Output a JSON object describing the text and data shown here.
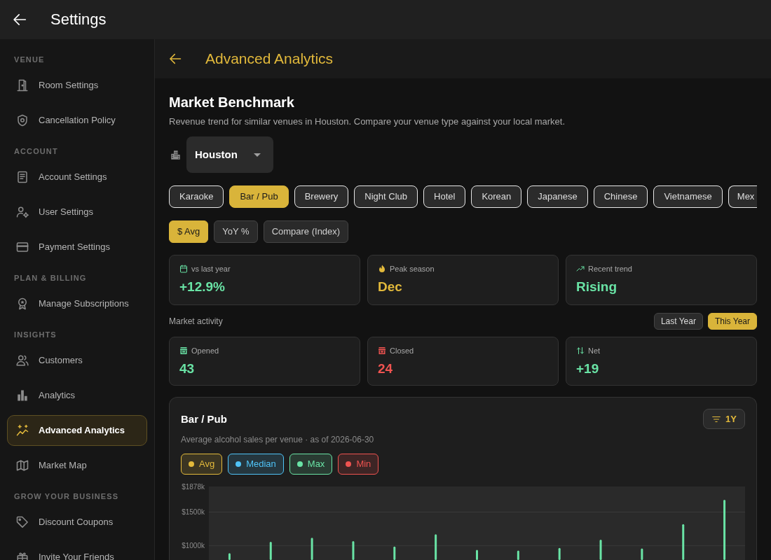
{
  "app_bar": {
    "title": "Settings"
  },
  "sidebar": {
    "sections": [
      {
        "heading": "VENUE",
        "items": [
          {
            "label": "Room Settings",
            "selected": false
          },
          {
            "label": "Cancellation Policy",
            "selected": false
          }
        ]
      },
      {
        "heading": "ACCOUNT",
        "items": [
          {
            "label": "Account Settings",
            "selected": false
          },
          {
            "label": "User Settings",
            "selected": false
          },
          {
            "label": "Payment Settings",
            "selected": false
          }
        ]
      },
      {
        "heading": "PLAN & BILLING",
        "items": [
          {
            "label": "Manage Subscriptions",
            "selected": false
          }
        ]
      },
      {
        "heading": "INSIGHTS",
        "items": [
          {
            "label": "Customers",
            "selected": false
          },
          {
            "label": "Analytics",
            "selected": false
          },
          {
            "label": "Advanced Analytics",
            "selected": true
          },
          {
            "label": "Market Map",
            "selected": false
          }
        ]
      },
      {
        "heading": "GROW YOUR BUSINESS",
        "items": [
          {
            "label": "Discount Coupons",
            "selected": false
          },
          {
            "label": "Invite Your Friends",
            "selected": false
          }
        ]
      }
    ]
  },
  "page_header": {
    "title": "Advanced Analytics"
  },
  "benchmark": {
    "title": "Market Benchmark",
    "description": "Revenue trend for similar venues in Houston. Compare your venue type against your local market.",
    "city_select": {
      "value": "Houston"
    },
    "venue_types": [
      {
        "label": "Karaoke",
        "selected": false
      },
      {
        "label": "Bar / Pub",
        "selected": true
      },
      {
        "label": "Brewery",
        "selected": false
      },
      {
        "label": "Night Club",
        "selected": false
      },
      {
        "label": "Hotel",
        "selected": false
      },
      {
        "label": "Korean",
        "selected": false
      },
      {
        "label": "Japanese",
        "selected": false
      },
      {
        "label": "Chinese",
        "selected": false
      },
      {
        "label": "Vietnamese",
        "selected": false
      },
      {
        "label": "Mex",
        "selected": false
      }
    ],
    "modes": [
      {
        "label": "$ Avg",
        "selected": true
      },
      {
        "label": "YoY %",
        "selected": false
      },
      {
        "label": "Compare (Index)",
        "selected": false
      }
    ],
    "stats": [
      {
        "label": "vs last year",
        "value": "+12.9%",
        "color": "#69e3a5"
      },
      {
        "label": "Peak season",
        "value": "Dec",
        "color": "#e2b93b"
      },
      {
        "label": "Recent trend",
        "value": "Rising",
        "color": "#69e3a5"
      }
    ],
    "market_activity": {
      "label": "Market activity",
      "periods": [
        {
          "label": "Last Year",
          "selected": false
        },
        {
          "label": "This Year",
          "selected": true
        }
      ],
      "stats": [
        {
          "label": "Opened",
          "value": "43",
          "color": "#69e3a5"
        },
        {
          "label": "Closed",
          "value": "24",
          "color": "#ef5350"
        },
        {
          "label": "Net",
          "value": "+19",
          "color": "#69e3a5"
        }
      ]
    }
  },
  "chart": {
    "title": "Bar / Pub",
    "range_button": "1Y",
    "subtitle": "Average alcohol sales per venue · as of 2026-06-30",
    "legend": [
      {
        "label": "Avg",
        "color": "#e2b93b"
      },
      {
        "label": "Median",
        "color": "#4fc3f7"
      },
      {
        "label": "Max",
        "color": "#69e3a5"
      },
      {
        "label": "Min",
        "color": "#ef5350"
      }
    ],
    "chart_data": {
      "type": "bar",
      "series": [
        {
          "color": "#69e3a5",
          "values": [
            890,
            1060,
            1120,
            1070,
            990,
            1170,
            940,
            930,
            970,
            1090,
            960,
            1320,
            1680
          ]
        }
      ],
      "ylim": [
        790,
        1878
      ],
      "yticks": [
        {
          "value": 1878,
          "label": "$1878k"
        },
        {
          "value": 1500,
          "label": "$1500k"
        },
        {
          "value": 1000,
          "label": "$1000k"
        }
      ]
    }
  }
}
